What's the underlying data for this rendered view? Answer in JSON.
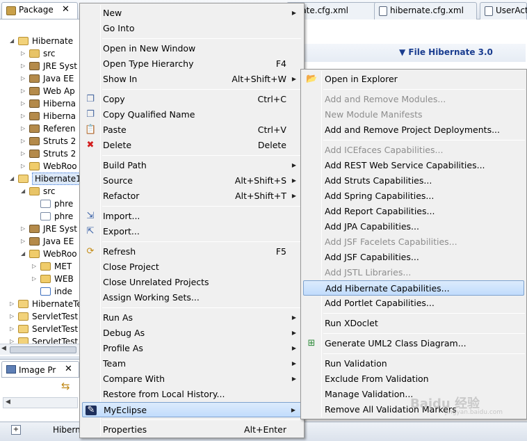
{
  "package_view": {
    "tab_label": "Package",
    "close_glyph": "✕",
    "tree": [
      {
        "label": "Hibernate",
        "depth": 0,
        "icon": "project-icon",
        "expanded": true
      },
      {
        "label": "src",
        "depth": 1,
        "icon": "source-folder-icon",
        "expanded": false
      },
      {
        "label": "JRE Syst",
        "depth": 1,
        "icon": "library-icon",
        "expanded": false
      },
      {
        "label": "Java EE",
        "depth": 1,
        "icon": "library-icon",
        "expanded": false
      },
      {
        "label": "Web Ap",
        "depth": 1,
        "icon": "library-icon",
        "expanded": false
      },
      {
        "label": "Hiberna",
        "depth": 1,
        "icon": "library-icon",
        "expanded": false
      },
      {
        "label": "Hiberna",
        "depth": 1,
        "icon": "library-icon",
        "expanded": false
      },
      {
        "label": "Referen",
        "depth": 1,
        "icon": "library-icon",
        "expanded": false
      },
      {
        "label": "Struts 2",
        "depth": 1,
        "icon": "library-icon",
        "expanded": false
      },
      {
        "label": "Struts 2",
        "depth": 1,
        "icon": "library-icon",
        "expanded": false
      },
      {
        "label": "WebRoo",
        "depth": 1,
        "icon": "folder-icon",
        "expanded": false
      },
      {
        "label": "Hibernate1",
        "depth": 0,
        "icon": "project-icon",
        "expanded": true,
        "selected": true
      },
      {
        "label": "src",
        "depth": 1,
        "icon": "source-folder-icon",
        "expanded": true
      },
      {
        "label": "phre",
        "depth": 2,
        "icon": "package-icon",
        "expanded": null
      },
      {
        "label": "phre",
        "depth": 2,
        "icon": "package-icon",
        "expanded": null
      },
      {
        "label": "JRE Syst",
        "depth": 1,
        "icon": "library-icon",
        "expanded": false
      },
      {
        "label": "Java EE",
        "depth": 1,
        "icon": "library-icon",
        "expanded": false
      },
      {
        "label": "WebRoo",
        "depth": 1,
        "icon": "folder-icon",
        "expanded": true
      },
      {
        "label": "MET",
        "depth": 2,
        "icon": "folder-icon",
        "expanded": false
      },
      {
        "label": "WEB",
        "depth": 2,
        "icon": "folder-icon",
        "expanded": false
      },
      {
        "label": "inde",
        "depth": 2,
        "icon": "jsp-file-icon",
        "expanded": null
      },
      {
        "label": "HibernateTe",
        "depth": 0,
        "icon": "project-icon",
        "expanded": false
      },
      {
        "label": "ServletTest",
        "depth": 0,
        "icon": "project-icon",
        "expanded": false
      },
      {
        "label": "ServletTest",
        "depth": 0,
        "icon": "project-icon",
        "expanded": false
      },
      {
        "label": "ServletTest",
        "depth": 0,
        "icon": "project-icon",
        "expanded": false
      }
    ]
  },
  "image_view": {
    "tab_label": "Image Pr",
    "close_glyph": "✕"
  },
  "status_bar": {
    "text": "Hibern"
  },
  "editor": {
    "tabs": [
      {
        "label": "rnate.cfg.xml"
      },
      {
        "label": "hibernate.cfg.xml"
      },
      {
        "label": "UserAct"
      }
    ],
    "section_title": "▼ File Hibernate 3.0"
  },
  "context_menu": [
    {
      "type": "item",
      "label": "New",
      "submenu": true
    },
    {
      "type": "item",
      "label": "Go Into"
    },
    {
      "type": "separator"
    },
    {
      "type": "item",
      "label": "Open in New Window"
    },
    {
      "type": "item",
      "label": "Open Type Hierarchy",
      "accelerator": "F4"
    },
    {
      "type": "item",
      "label": "Show In",
      "accelerator": "Alt+Shift+W",
      "submenu": true
    },
    {
      "type": "separator"
    },
    {
      "type": "item",
      "label": "Copy",
      "accelerator": "Ctrl+C",
      "icon": "copy-icon",
      "glyph": "❐"
    },
    {
      "type": "item",
      "label": "Copy Qualified Name",
      "icon": "copy-qualified-name-icon",
      "glyph": "❐"
    },
    {
      "type": "item",
      "label": "Paste",
      "accelerator": "Ctrl+V",
      "icon": "paste-icon",
      "glyph": "📋"
    },
    {
      "type": "item",
      "label": "Delete",
      "accelerator": "Delete",
      "icon": "delete-icon",
      "glyph": "✖"
    },
    {
      "type": "separator"
    },
    {
      "type": "item",
      "label": "Build Path",
      "submenu": true
    },
    {
      "type": "item",
      "label": "Source",
      "accelerator": "Alt+Shift+S",
      "submenu": true
    },
    {
      "type": "item",
      "label": "Refactor",
      "accelerator": "Alt+Shift+T",
      "submenu": true
    },
    {
      "type": "separator"
    },
    {
      "type": "item",
      "label": "Import...",
      "icon": "import-icon",
      "glyph": "⇲"
    },
    {
      "type": "item",
      "label": "Export...",
      "icon": "export-icon",
      "glyph": "⇱"
    },
    {
      "type": "separator"
    },
    {
      "type": "item",
      "label": "Refresh",
      "accelerator": "F5",
      "icon": "refresh-icon",
      "glyph": "⟳"
    },
    {
      "type": "item",
      "label": "Close Project"
    },
    {
      "type": "item",
      "label": "Close Unrelated Projects"
    },
    {
      "type": "item",
      "label": "Assign Working Sets..."
    },
    {
      "type": "separator"
    },
    {
      "type": "item",
      "label": "Run As",
      "submenu": true
    },
    {
      "type": "item",
      "label": "Debug As",
      "submenu": true
    },
    {
      "type": "item",
      "label": "Profile As",
      "submenu": true
    },
    {
      "type": "item",
      "label": "Team",
      "submenu": true
    },
    {
      "type": "item",
      "label": "Compare With",
      "submenu": true
    },
    {
      "type": "item",
      "label": "Restore from Local History..."
    },
    {
      "type": "item",
      "label": "MyEclipse",
      "submenu": true,
      "highlighted": true,
      "icon": "myeclipse-icon",
      "glyph": "✎"
    },
    {
      "type": "separator"
    },
    {
      "type": "item",
      "label": "Properties",
      "accelerator": "Alt+Enter"
    }
  ],
  "myeclipse_submenu": [
    {
      "type": "item",
      "label": "Open in Explorer",
      "icon": "explorer-folder-icon",
      "glyph": "📂"
    },
    {
      "type": "separator"
    },
    {
      "type": "item",
      "label": "Add and Remove Modules...",
      "disabled": true
    },
    {
      "type": "item",
      "label": "New Module Manifests",
      "disabled": true
    },
    {
      "type": "item",
      "label": "Add and Remove Project Deployments..."
    },
    {
      "type": "separator"
    },
    {
      "type": "item",
      "label": "Add ICEfaces Capabilities...",
      "disabled": true
    },
    {
      "type": "item",
      "label": "Add REST Web Service Capabilities..."
    },
    {
      "type": "item",
      "label": "Add Struts Capabilities..."
    },
    {
      "type": "item",
      "label": "Add Spring Capabilities..."
    },
    {
      "type": "item",
      "label": "Add Report Capabilities..."
    },
    {
      "type": "item",
      "label": "Add JPA Capabilities..."
    },
    {
      "type": "item",
      "label": "Add JSF Facelets Capabilities...",
      "disabled": true
    },
    {
      "type": "item",
      "label": "Add JSF Capabilities..."
    },
    {
      "type": "item",
      "label": "Add JSTL Libraries...",
      "disabled": true
    },
    {
      "type": "item",
      "label": "Add Hibernate Capabilities...",
      "highlighted": true
    },
    {
      "type": "item",
      "label": "Add Portlet Capabilities..."
    },
    {
      "type": "separator"
    },
    {
      "type": "item",
      "label": "Run XDoclet"
    },
    {
      "type": "separator"
    },
    {
      "type": "item",
      "label": "Generate UML2 Class Diagram...",
      "icon": "uml-diagram-icon",
      "glyph": "⊞"
    },
    {
      "type": "separator"
    },
    {
      "type": "item",
      "label": "Run Validation"
    },
    {
      "type": "item",
      "label": "Exclude From Validation"
    },
    {
      "type": "item",
      "label": "Manage Validation..."
    },
    {
      "type": "item",
      "label": "Remove All Validation Markers"
    }
  ],
  "watermark": {
    "text": "Baidu 经验",
    "subtext": "jingyan.baidu.com"
  }
}
